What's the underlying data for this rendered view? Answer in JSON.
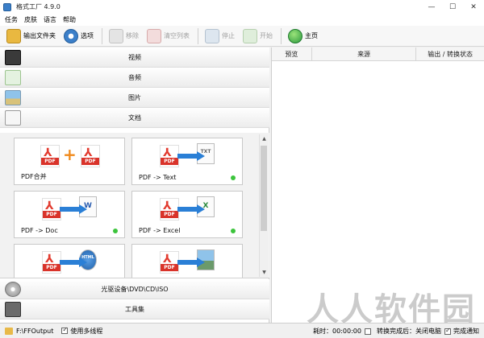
{
  "window": {
    "title": "格式工厂 4.9.0",
    "minimize": "—",
    "maximize": "☐",
    "close": "✕"
  },
  "menu": [
    "任务",
    "皮肤",
    "语言",
    "帮助"
  ],
  "toolbar": {
    "output_folder": "输出文件夹",
    "options": "选项",
    "remove": "移除",
    "clear_list": "清空列表",
    "stop": "停止",
    "start": "开始",
    "home": "主页"
  },
  "categories": {
    "video": "视频",
    "audio": "音频",
    "image": "图片",
    "document": "文档",
    "rom": "光驱设备\\DVD\\CD\\ISO",
    "tools": "工具集"
  },
  "tiles": [
    {
      "label": "PDF合并",
      "dot": false
    },
    {
      "label": "PDF -> Text",
      "dot": true,
      "badge": "TXT"
    },
    {
      "label": "PDF -> Doc",
      "dot": true,
      "badge": "W"
    },
    {
      "label": "PDF -> Excel",
      "dot": true,
      "badge": "X"
    },
    {
      "label": "",
      "dot": false,
      "badge": "HTML"
    },
    {
      "label": "",
      "dot": false
    }
  ],
  "pdf_tag": "PDF",
  "task_table": {
    "headers": [
      "预览",
      "来源",
      "输出 / 转换状态"
    ]
  },
  "status": {
    "output_path": "F:\\FFOutput",
    "multithread": "使用多线程",
    "elapsed_label": "耗时：00:00:00",
    "after_convert": "转换完成后：关闭电脑",
    "notify": "完成通知"
  },
  "watermark": "人人软件园",
  "colors": {
    "accent": "#2a7fd6",
    "pdf_red": "#d9332a",
    "status_dot": "#3cc43c"
  }
}
